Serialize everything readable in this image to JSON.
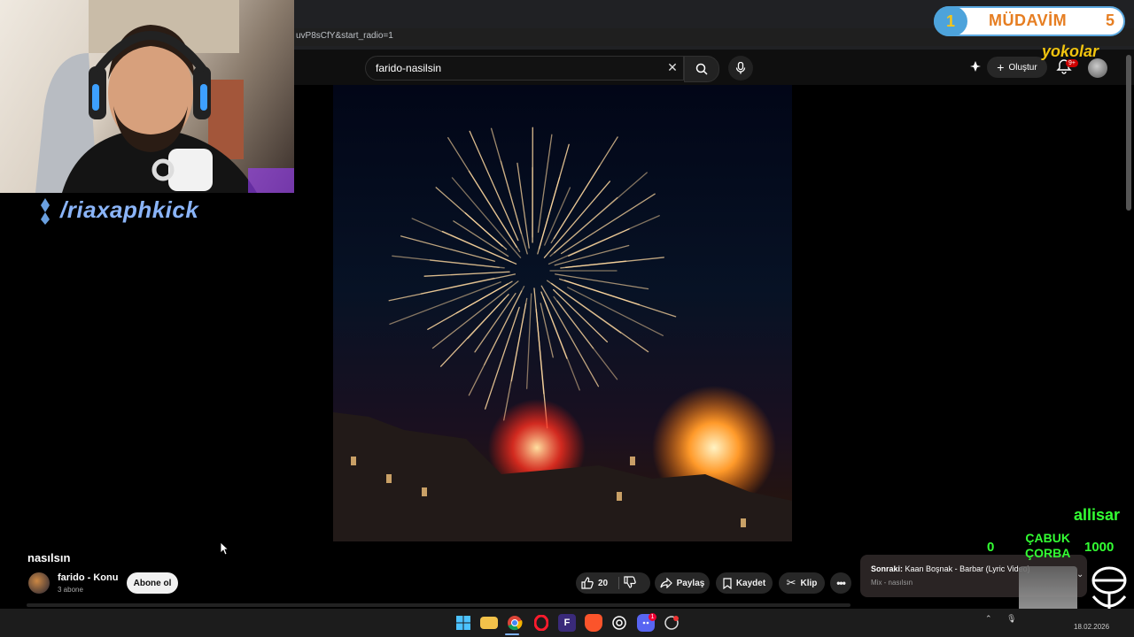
{
  "browser": {
    "url_fragment": "uvP8sCfY&start_radio=1"
  },
  "youtube": {
    "search_value": "farido-nasilsin",
    "create_label": "Oluştur",
    "notification_count": "9+"
  },
  "video": {
    "title": "nasılsın",
    "channel_name": "farido - Konu",
    "subscribers": "3 abone",
    "subscribe_label": "Abone ol",
    "like_count": "20",
    "share_label": "Paylaş",
    "save_label": "Kaydet",
    "clip_label": "Klip"
  },
  "up_next": {
    "prefix": "Sonraki:",
    "title": "Kaan Boşnak - Barbar (Lyric Video)",
    "subtitle": "Mix - nasılsın"
  },
  "stream_overlay": {
    "kick_handle": "/riaxaphkick",
    "badge_left_number": "1",
    "badge_title": "MÜDAVİM",
    "badge_right_number": "5",
    "badge_user": "yokolar",
    "chat_user": "allisar",
    "score_left": "0",
    "game_title_line1": "ÇABUK",
    "game_title_line2": "ÇORBA",
    "score_right": "1000"
  },
  "taskbar": {
    "date": "18.02.2026",
    "discord_badge": "1"
  },
  "colors": {
    "yt_bg": "#0f0f0f",
    "kick_text": "#8ab4f8",
    "overlay_green": "#33ff33",
    "badge_orange": "#e67e22"
  }
}
